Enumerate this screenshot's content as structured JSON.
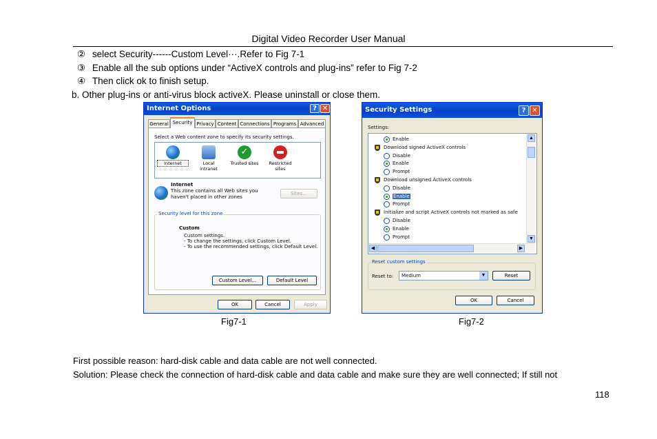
{
  "document": {
    "header": "Digital Video Recorder User Manual",
    "steps": [
      {
        "marker": "②",
        "text": "select Security------Custom Level···.Refer to Fig 7-1"
      },
      {
        "marker": "③",
        "text": "Enable all the sub options under “ActiveX controls and plug-ins” refer to Fig 7-2"
      },
      {
        "marker": "④",
        "text": "Then click ok to finish setup."
      }
    ],
    "note_b": "b. Other plug-ins or anti-virus block activeX. Please uninstall or close them.",
    "fig1_caption": "Fig7-1",
    "fig2_caption": "Fig7-2",
    "reason": "First possible reason: hard-disk cable and data cable are not well connected.",
    "solution": "Solution: Please check the connection of hard-disk cable and data cable and make sure they are well connected; If still not",
    "page_number": "118"
  },
  "internet_options": {
    "title": "Internet Options",
    "help_glyph": "?",
    "close_glyph": "✕",
    "tabs": [
      "General",
      "Security",
      "Privacy",
      "Content",
      "Connections",
      "Programs",
      "Advanced"
    ],
    "active_tab": "Security",
    "zone_prompt": "Select a Web content zone to specify its security settings.",
    "zones": [
      {
        "label": "Internet",
        "icon": "globe-icon",
        "color": "#2f7fd8"
      },
      {
        "label": "Local intranet",
        "icon": "intranet-icon",
        "color": "#5a8fd0"
      },
      {
        "label": "Trusted sites",
        "icon": "checkmark-icon",
        "color": "#1f9a2e"
      },
      {
        "label": "Restricted\nsites",
        "icon": "no-entry-icon",
        "color": "#d02020"
      }
    ],
    "zone_title": "Internet",
    "zone_desc": "This zone contains all Web sites you\nhaven't placed in other zones",
    "sites_button": "Sites...",
    "security_group_label": "Security level for this zone",
    "level_title": "Custom",
    "level_desc": "Custom settings.\n- To change the settings, click Custom Level.\n- To use the recommended settings, click Default Level.",
    "custom_level_button": "Custom Level...",
    "default_level_button": "Default Level",
    "ok": "OK",
    "cancel": "Cancel",
    "apply": "Apply"
  },
  "security_settings": {
    "title": "Security Settings",
    "help_glyph": "?",
    "close_glyph": "✕",
    "settings_label": "Settings:",
    "items": [
      {
        "kind": "radio",
        "label": "Enable",
        "checked": true
      },
      {
        "kind": "heading",
        "label": "Download signed ActiveX controls"
      },
      {
        "kind": "radio",
        "label": "Disable",
        "checked": false
      },
      {
        "kind": "radio",
        "label": "Enable",
        "checked": true
      },
      {
        "kind": "radio",
        "label": "Prompt",
        "checked": false
      },
      {
        "kind": "heading",
        "label": "Download unsigned ActiveX controls"
      },
      {
        "kind": "radio",
        "label": "Disable",
        "checked": false
      },
      {
        "kind": "radio",
        "label": "Enable",
        "checked": true,
        "selected": true
      },
      {
        "kind": "radio",
        "label": "Prompt",
        "checked": false
      },
      {
        "kind": "heading",
        "label": "Initialize and script ActiveX controls not marked as safe"
      },
      {
        "kind": "radio",
        "label": "Disable",
        "checked": false
      },
      {
        "kind": "radio",
        "label": "Enable",
        "checked": true
      },
      {
        "kind": "radio",
        "label": "Prompt",
        "checked": false
      }
    ],
    "reset_group_label": "Reset custom settings",
    "reset_to_label": "Reset to:",
    "reset_value": "Medium",
    "reset_button": "Reset",
    "ok": "OK",
    "cancel": "Cancel"
  }
}
